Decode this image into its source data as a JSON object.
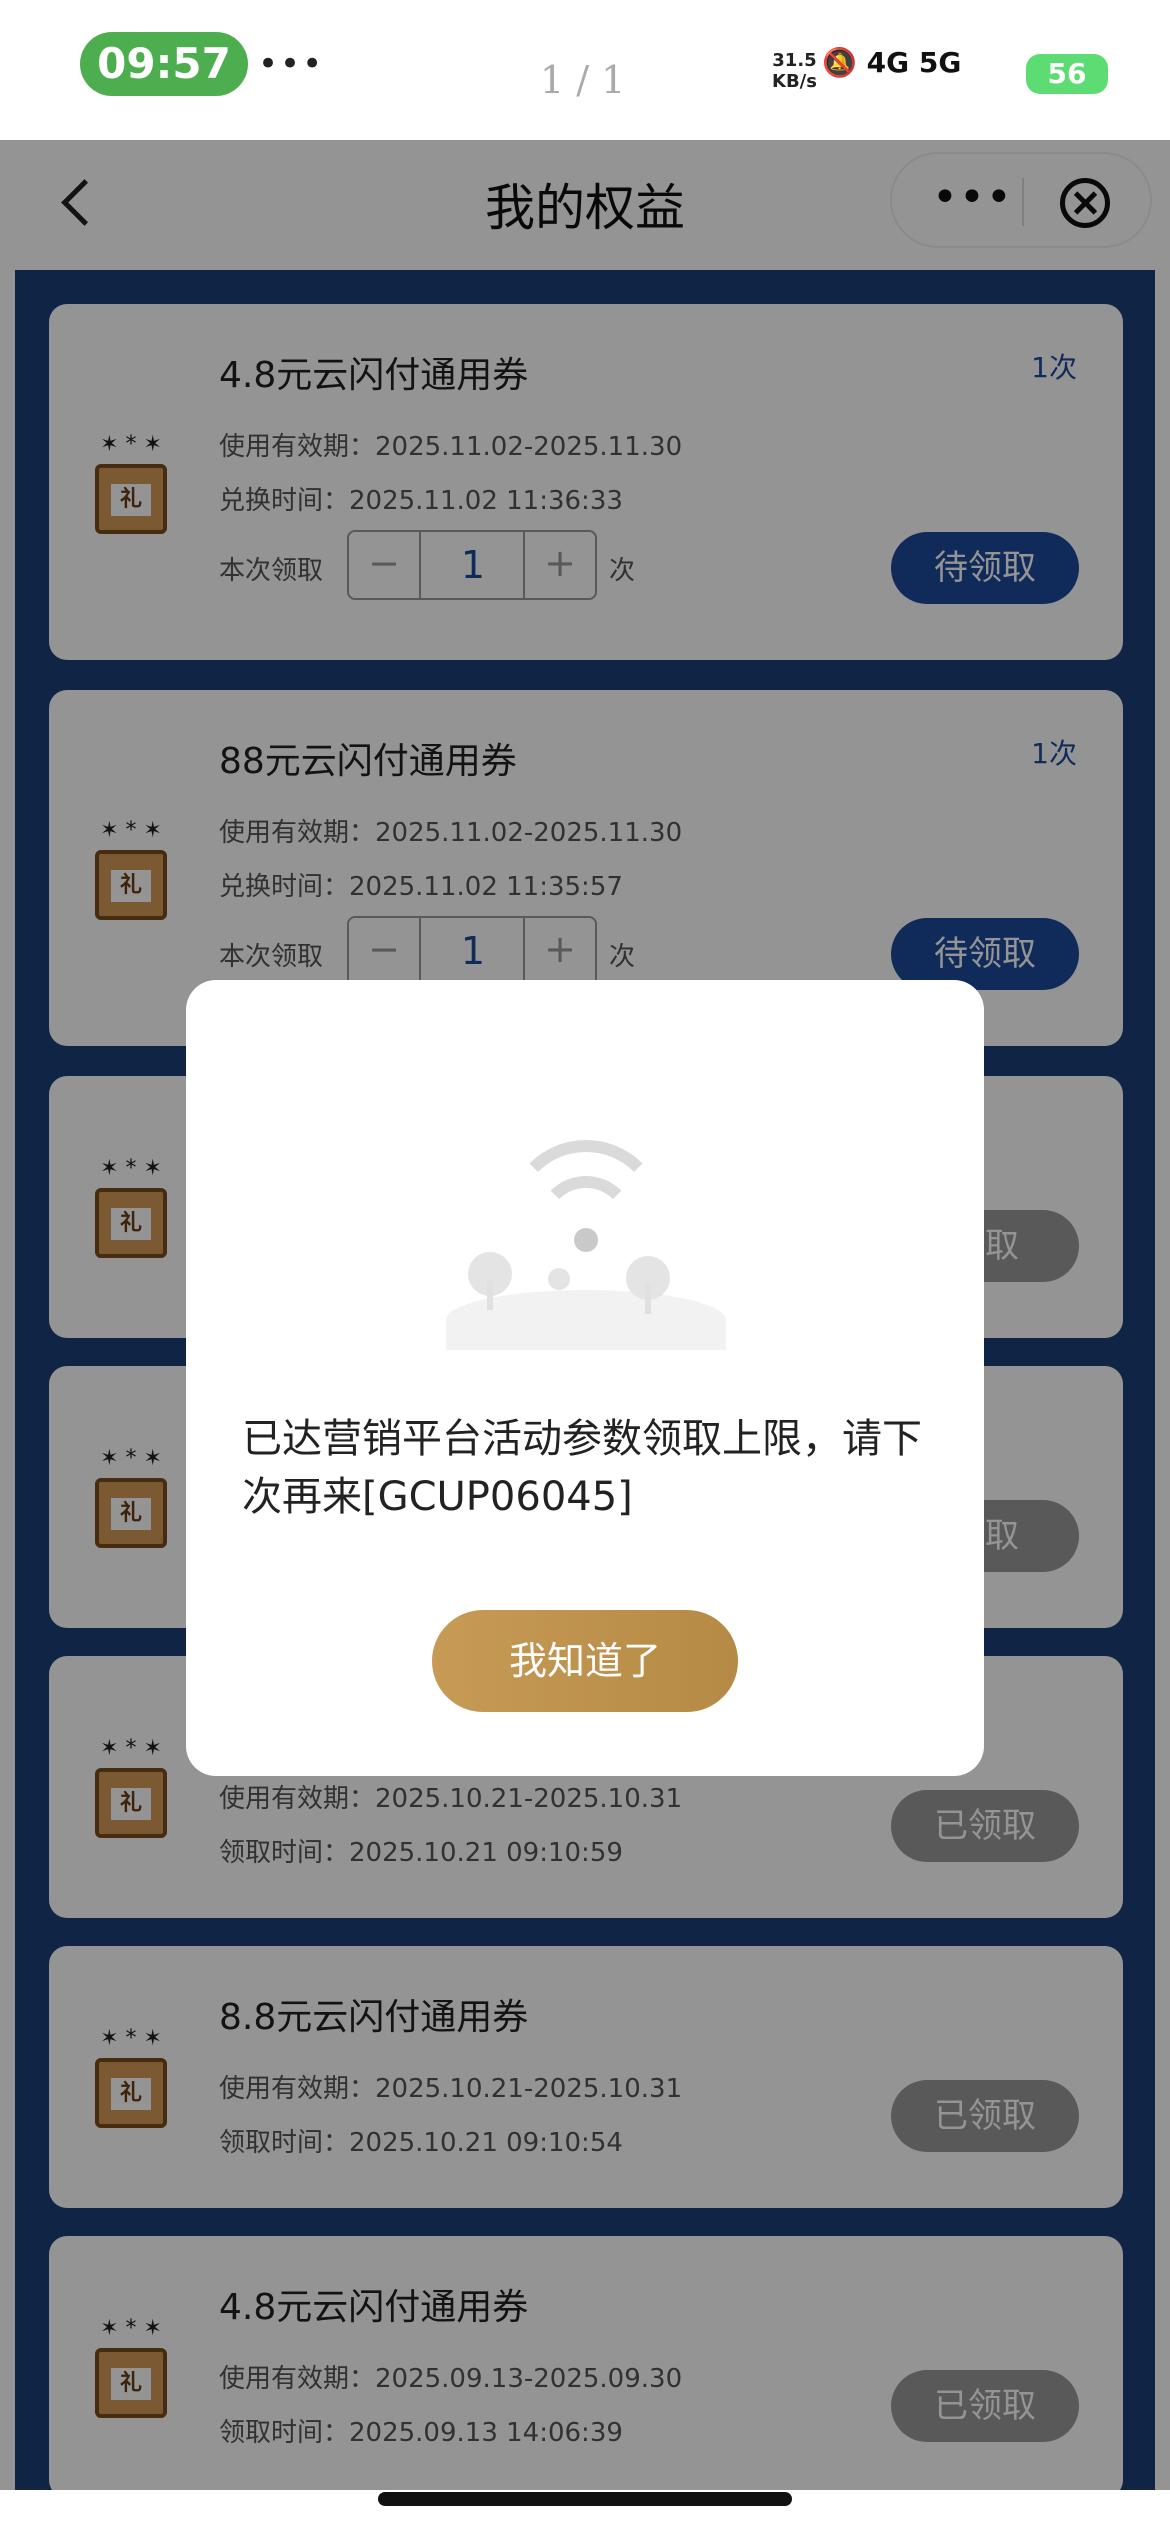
{
  "status_bar": {
    "time": "09:57",
    "more": "•••",
    "page_indicator": "1 / 1",
    "net_speed_value": "31.5",
    "net_speed_unit": "KB/s",
    "signal": "4G 5G",
    "battery": "56"
  },
  "nav": {
    "title": "我的权益",
    "more": "•••"
  },
  "cards": [
    {
      "title": "4.8元云闪付通用券",
      "validity": "使用有效期：2025.11.02-2025.11.30",
      "time": "兑换时间：2025.11.02 11:36:33",
      "count": "1次",
      "step_label": "本次领取",
      "qty": "1",
      "unit": "次",
      "button": "待领取"
    },
    {
      "title": "88元云闪付通用券",
      "validity": "使用有效期：2025.11.02-2025.11.30",
      "time": "兑换时间：2025.11.02 11:35:57",
      "count": "1次",
      "step_label": "本次领取",
      "qty": "1",
      "unit": "次",
      "button": "待领取"
    },
    {
      "button": "领取"
    },
    {
      "button": "领取"
    },
    {
      "validity": "使用有效期：2025.10.21-2025.10.31",
      "time": "领取时间：2025.10.21 09:10:59",
      "button": "已领取"
    },
    {
      "title": "8.8元云闪付通用券",
      "validity": "使用有效期：2025.10.21-2025.10.31",
      "time": "领取时间：2025.10.21 09:10:54",
      "button": "已领取"
    },
    {
      "title": "4.8元云闪付通用券",
      "validity": "使用有效期：2025.09.13-2025.09.30",
      "time": "领取时间：2025.09.13 14:06:39",
      "button": "已领取"
    }
  ],
  "gift_label": "礼",
  "modal": {
    "message": "已达营销平台活动参数领取上限，请下次再来[GCUP06045]",
    "button": "我知道了"
  }
}
